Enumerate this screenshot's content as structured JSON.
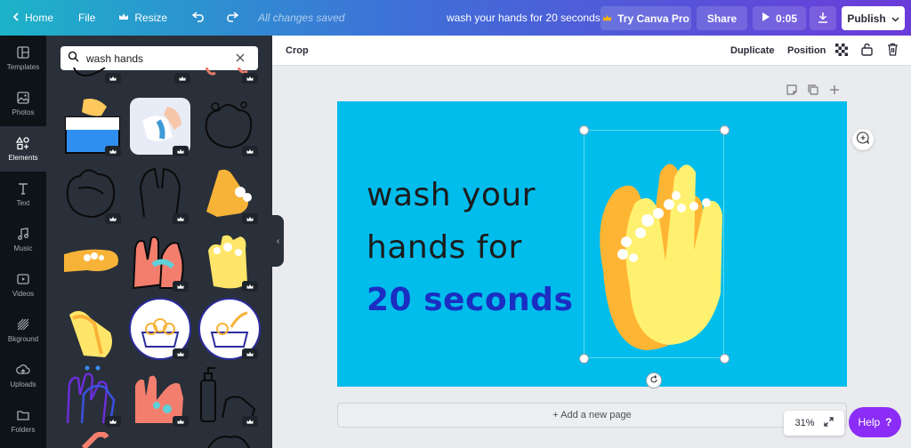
{
  "topbar": {
    "home": "Home",
    "file": "File",
    "resize": "Resize",
    "saved_status": "All changes saved",
    "doc_title": "wash your hands for 20 seconds",
    "try_pro": "Try Canva Pro",
    "share": "Share",
    "duration": "0:05",
    "publish": "Publish",
    "gradient_colors": [
      "#1cb3c8",
      "#3f6fd8",
      "#6b3bd9"
    ]
  },
  "rail": {
    "items": [
      {
        "label": "Templates",
        "icon": "templates-icon"
      },
      {
        "label": "Photos",
        "icon": "photos-icon"
      },
      {
        "label": "Elements",
        "icon": "elements-icon",
        "active": true
      },
      {
        "label": "Text",
        "icon": "text-icon"
      },
      {
        "label": "Music",
        "icon": "music-icon"
      },
      {
        "label": "Videos",
        "icon": "videos-icon"
      },
      {
        "label": "Bkground",
        "icon": "background-icon"
      },
      {
        "label": "Uploads",
        "icon": "uploads-icon"
      },
      {
        "label": "Folders",
        "icon": "folders-icon"
      }
    ]
  },
  "panel": {
    "search_value": "wash hands",
    "result_count_visible": 15
  },
  "toolbar": {
    "crop": "Crop",
    "duplicate": "Duplicate",
    "position": "Position"
  },
  "design": {
    "line1": "wash your",
    "line2": "hands for",
    "line3": "20 seconds",
    "background": "#00bdec",
    "accent": "#1b2ec2"
  },
  "footer": {
    "add_page": "+ Add a new page",
    "zoom": "31%",
    "help": "Help",
    "help_mark": "?"
  }
}
